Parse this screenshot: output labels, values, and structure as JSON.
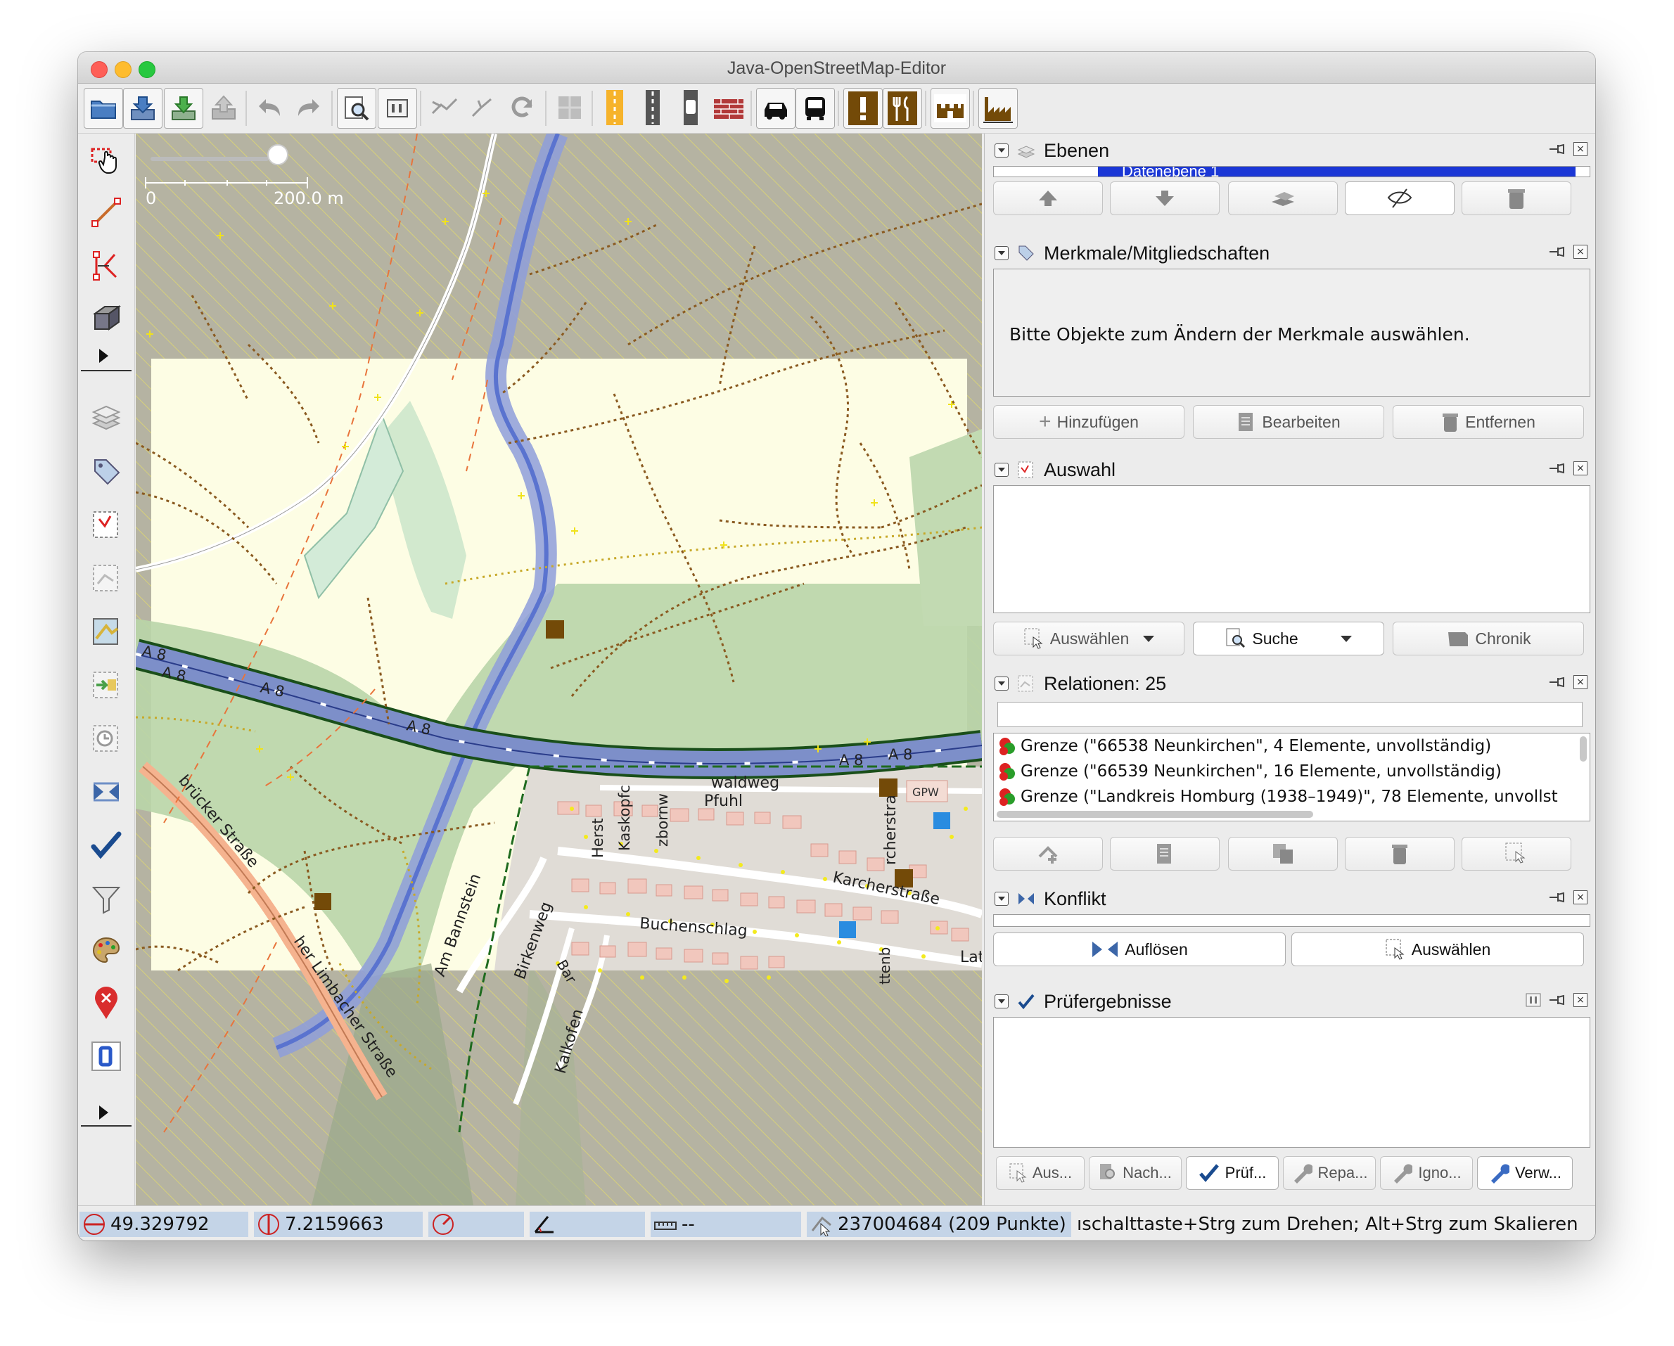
{
  "window": {
    "title": "Java-OpenStreetMap-Editor"
  },
  "toolbar": {
    "buttons": [
      "open-file",
      "download",
      "download-data",
      "upload",
      "undo",
      "redo",
      "zoom-to-selection",
      "preferences",
      "combine-way",
      "split-way",
      "refresh",
      "imagery",
      "street-residential",
      "street-tertiary",
      "traffic-signals",
      "wall",
      "car",
      "bus",
      "attention",
      "restaurant",
      "castle",
      "industrial"
    ]
  },
  "map": {
    "scale_zero": "0",
    "scale_length": "200.0 m",
    "labels": {
      "a8_1": "A 8",
      "a8_2": "A 8",
      "a8_3": "A 8",
      "a8_4": "A 8",
      "a8_5": "A 8",
      "a8_6": "A 8",
      "waldweg": "waldweg",
      "pfuhl": "Pfuhl",
      "gpw": "GPW",
      "brucker": "brücker Straße",
      "limbacher": "her Limbacher Straße",
      "am_bannstein": "Am Bannstein",
      "birkenweg": "Birkenweg",
      "buchenschlag": "Buchenschlag",
      "kalkofen": "Kalkofen",
      "karcher": "Karcherstraße",
      "kirchstr": "rcherstra",
      "hersb": "Herst",
      "kaskopf": "Kaskopfc",
      "zborn": "zbornw",
      "lat": "Lat",
      "bar": "Bar",
      "ttenb": "ttenb"
    }
  },
  "panels": {
    "layers": {
      "title": "Ebenen",
      "layer_name": "Datenebene 1"
    },
    "tags": {
      "title": "Merkmale/Mitgliedschaften",
      "empty_message": "Bitte Objekte zum Ändern der Merkmale auswählen.",
      "add": "Hinzufügen",
      "edit": "Bearbeiten",
      "remove": "Entfernen"
    },
    "selection": {
      "title": "Auswahl",
      "select": "Auswählen",
      "search": "Suche",
      "history": "Chronik"
    },
    "relations": {
      "title": "Relationen: 25",
      "filter_value": "",
      "items": [
        "Grenze (\"66538 Neunkirchen\", 4 Elemente, unvollständig)",
        "Grenze (\"66539 Neunkirchen\", 16 Elemente, unvollständig)",
        "Grenze (\"Landkreis Homburg (1938–1949)\", 78 Elemente, unvollst"
      ]
    },
    "conflict": {
      "title": "Konflikt",
      "resolve": "Auflösen",
      "select": "Auswählen"
    },
    "validation": {
      "title": "Prüfergebnisse",
      "buttons": [
        "Aus...",
        "Nach...",
        "Prüf...",
        "Repa...",
        "Igno...",
        "Verw..."
      ]
    }
  },
  "status": {
    "latitude": "49.329792",
    "longitude": "7.2159663",
    "heading": "",
    "angle": "",
    "distance": "--",
    "way_info": "237004684 (209 Punkte)",
    "help": "ıschalttaste+Strg zum Drehen; Alt+Strg zum Skalieren"
  },
  "colors": {
    "motorway": "#7b8fc7",
    "forest": "#add19e",
    "farmland": "#fefee5",
    "track": "#996600",
    "selection_blue": "#1b37d6",
    "status_field": "#c4d4e7"
  }
}
